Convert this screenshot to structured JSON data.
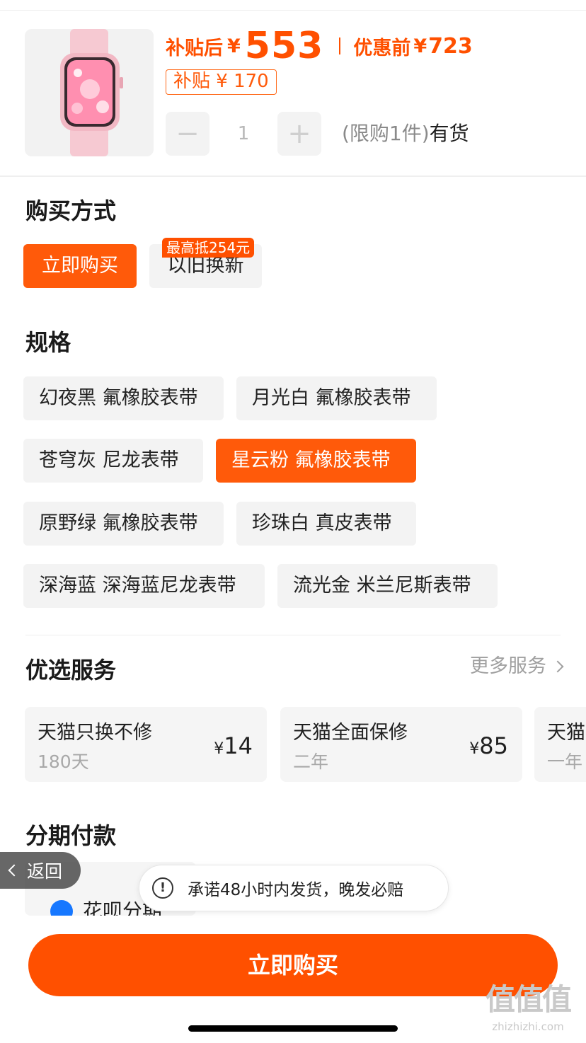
{
  "product": {
    "image_icon": "pink-smartwatch-image",
    "price_after_label": "补贴后",
    "currency": "¥",
    "price_after": "553",
    "price_before_label": "优惠前",
    "price_before": "723",
    "subsidy_label": "补贴 ¥ 170",
    "quantity": "1",
    "minus_symbol": "−",
    "plus_symbol": "+",
    "limit_text": "(限购1件)",
    "stock_text": "有货"
  },
  "purchase_method": {
    "title": "购买方式",
    "options": [
      {
        "label": "立即购买",
        "selected": true
      },
      {
        "label": "以旧换新",
        "selected": false
      }
    ],
    "promo_badge": "最高抵254元"
  },
  "specs": {
    "title": "规格",
    "options": [
      {
        "label": "幻夜黑 氟橡胶表带",
        "selected": false
      },
      {
        "label": "月光白 氟橡胶表带",
        "selected": false
      },
      {
        "label": "苍穹灰 尼龙表带",
        "selected": false
      },
      {
        "label": "星云粉 氟橡胶表带",
        "selected": true
      },
      {
        "label": "原野绿 氟橡胶表带",
        "selected": false
      },
      {
        "label": "珍珠白 真皮表带",
        "selected": false
      },
      {
        "label": "深海蓝 深海蓝尼龙表带",
        "selected": false
      },
      {
        "label": "流光金 米兰尼斯表带",
        "selected": false
      }
    ]
  },
  "services": {
    "title": "优选服务",
    "more_label": "更多服务",
    "items": [
      {
        "name": "天猫只换不修",
        "term": "180天",
        "yen": "¥",
        "price": "14"
      },
      {
        "name": "天猫全面保修",
        "term": "二年",
        "yen": "¥",
        "price": "85"
      },
      {
        "name": "天猫",
        "term": "一年",
        "yen": "",
        "price": ""
      }
    ]
  },
  "installment": {
    "title": "分期付款",
    "option_label": "花呗分期"
  },
  "back_button": {
    "label": "返回"
  },
  "toast": {
    "icon": "!",
    "text": "承诺48小时内发货，晚发必赔"
  },
  "buy_button": {
    "label": "立即购买"
  },
  "watermark": {
    "logo": "值值值",
    "url": "zhizhizhi.com"
  },
  "colors": {
    "accent": "#ff5000",
    "chip_bg": "#f3f3f3",
    "muted": "#a0a0a0"
  }
}
